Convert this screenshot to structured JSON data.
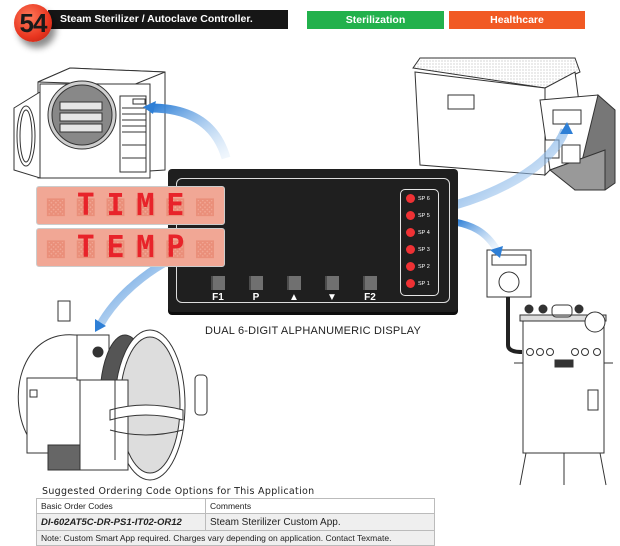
{
  "header": {
    "number": "54",
    "title": "Steam Sterilizer / Autoclave Controller.",
    "tags": [
      {
        "label": "Sterilization",
        "color": "#22b14c"
      },
      {
        "label": "Healthcare",
        "color": "#f15a24"
      }
    ]
  },
  "controller": {
    "display_line_1": [
      "",
      "T",
      "I",
      "M",
      "E",
      ""
    ],
    "display_line_2": [
      "",
      "T",
      "E",
      "M",
      "P",
      ""
    ],
    "setpoints": [
      "SP 6",
      "SP 5",
      "SP 4",
      "SP 3",
      "SP 2",
      "SP 1"
    ],
    "buttons": [
      "F1",
      "P",
      "▲",
      "▼",
      "F2"
    ],
    "caption": "DUAL 6-DIGIT ALPHANUMERIC  DISPLAY",
    "colors": {
      "display_bg": "#f1a795",
      "segment_on": "#e8232a",
      "led": "#ef3134"
    }
  },
  "illustrations": [
    "tabletop-autoclave-icon",
    "benchtop-sterilizer-icon",
    "pressure-vessel-sterilizer-icon",
    "horizontal-autoclave-icon"
  ],
  "ordering": {
    "title": "Suggested Ordering Code Options for This Application",
    "headers": [
      "Basic Order Codes",
      "Comments"
    ],
    "rows": [
      {
        "code": "DI-602AT5C-DR-PS1-IT02-OR12",
        "comment": "Steam Sterilizer Custom App."
      }
    ],
    "note": "Note: Custom Smart App required. Charges vary depending on application. Contact Texmate."
  }
}
